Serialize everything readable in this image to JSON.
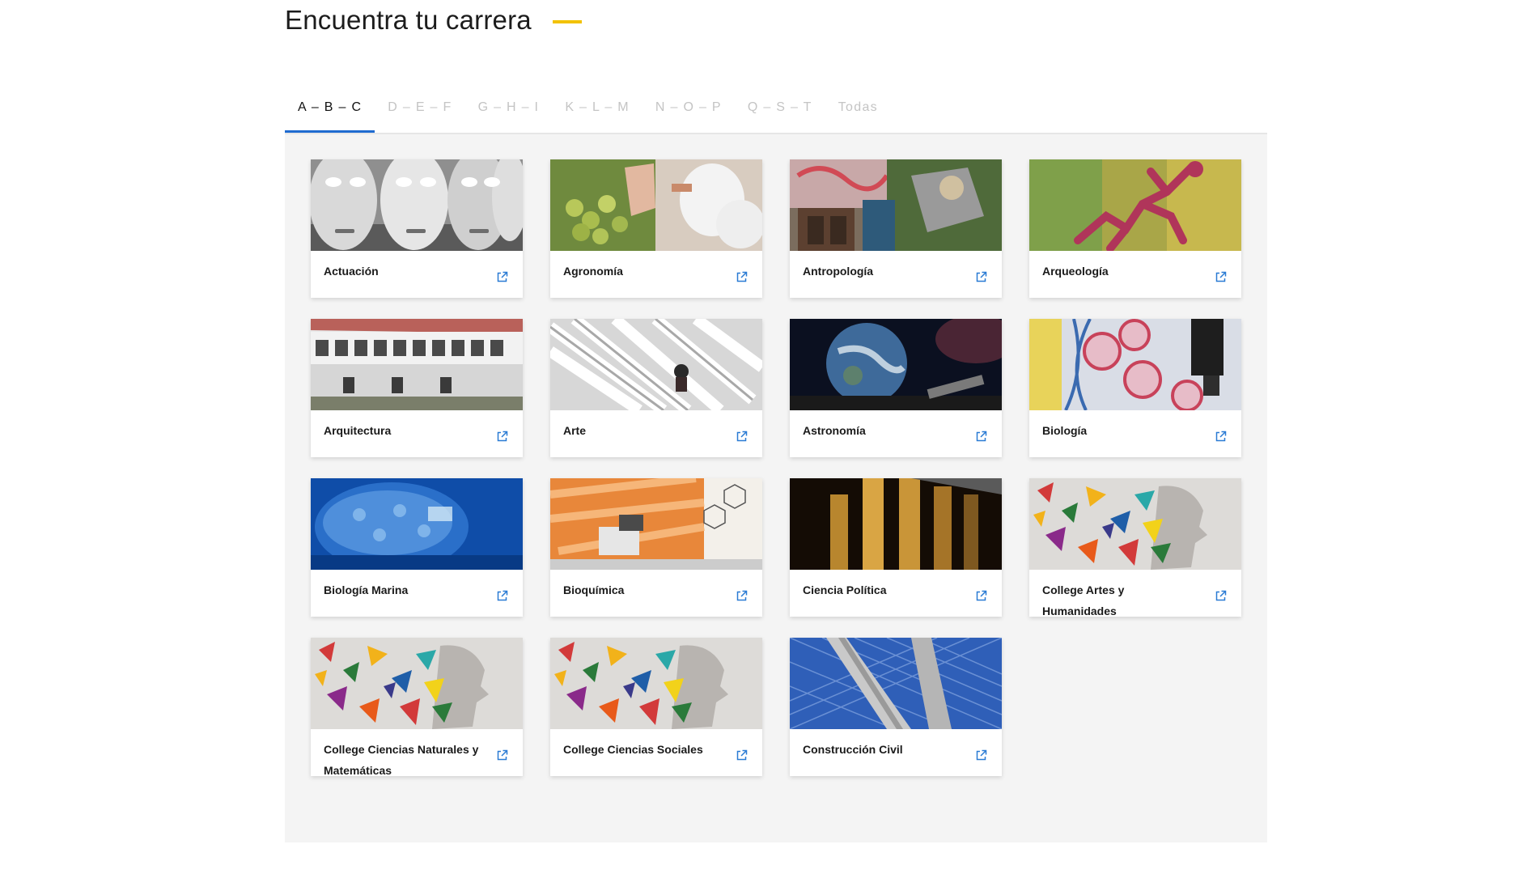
{
  "section": {
    "title": "Encuentra tu carrera"
  },
  "accent_colors": {
    "title_underline": "#f2c200",
    "active_tab": "#1f6bd0",
    "external_link_icon": "#2a7bd4"
  },
  "tabs": [
    {
      "label": "A – B – C",
      "active": true
    },
    {
      "label": "D – E – F",
      "active": false
    },
    {
      "label": "G – H – I",
      "active": false
    },
    {
      "label": "K – L – M",
      "active": false
    },
    {
      "label": "N – O – P",
      "active": false
    },
    {
      "label": "Q – S – T",
      "active": false
    },
    {
      "label": "Todas",
      "active": false
    }
  ],
  "careers": [
    {
      "label": "Actuación",
      "icon": "external-link-icon"
    },
    {
      "label": "Agronomía",
      "icon": "external-link-icon"
    },
    {
      "label": "Antropología",
      "icon": "external-link-icon"
    },
    {
      "label": "Arqueología",
      "icon": "external-link-icon"
    },
    {
      "label": "Arquitectura",
      "icon": "external-link-icon"
    },
    {
      "label": "Arte",
      "icon": "external-link-icon"
    },
    {
      "label": "Astronomía",
      "icon": "external-link-icon"
    },
    {
      "label": "Biología",
      "icon": "external-link-icon"
    },
    {
      "label": "Biología Marina",
      "icon": "external-link-icon"
    },
    {
      "label": "Bioquímica",
      "icon": "external-link-icon"
    },
    {
      "label": "Ciencia Política",
      "icon": "external-link-icon"
    },
    {
      "label": "College Artes y Humanidades",
      "icon": "external-link-icon"
    },
    {
      "label": "College Ciencias Naturales y Matemáticas",
      "icon": "external-link-icon"
    },
    {
      "label": "College Ciencias Sociales",
      "icon": "external-link-icon"
    },
    {
      "label": "Construcción Civil",
      "icon": "external-link-icon"
    }
  ]
}
